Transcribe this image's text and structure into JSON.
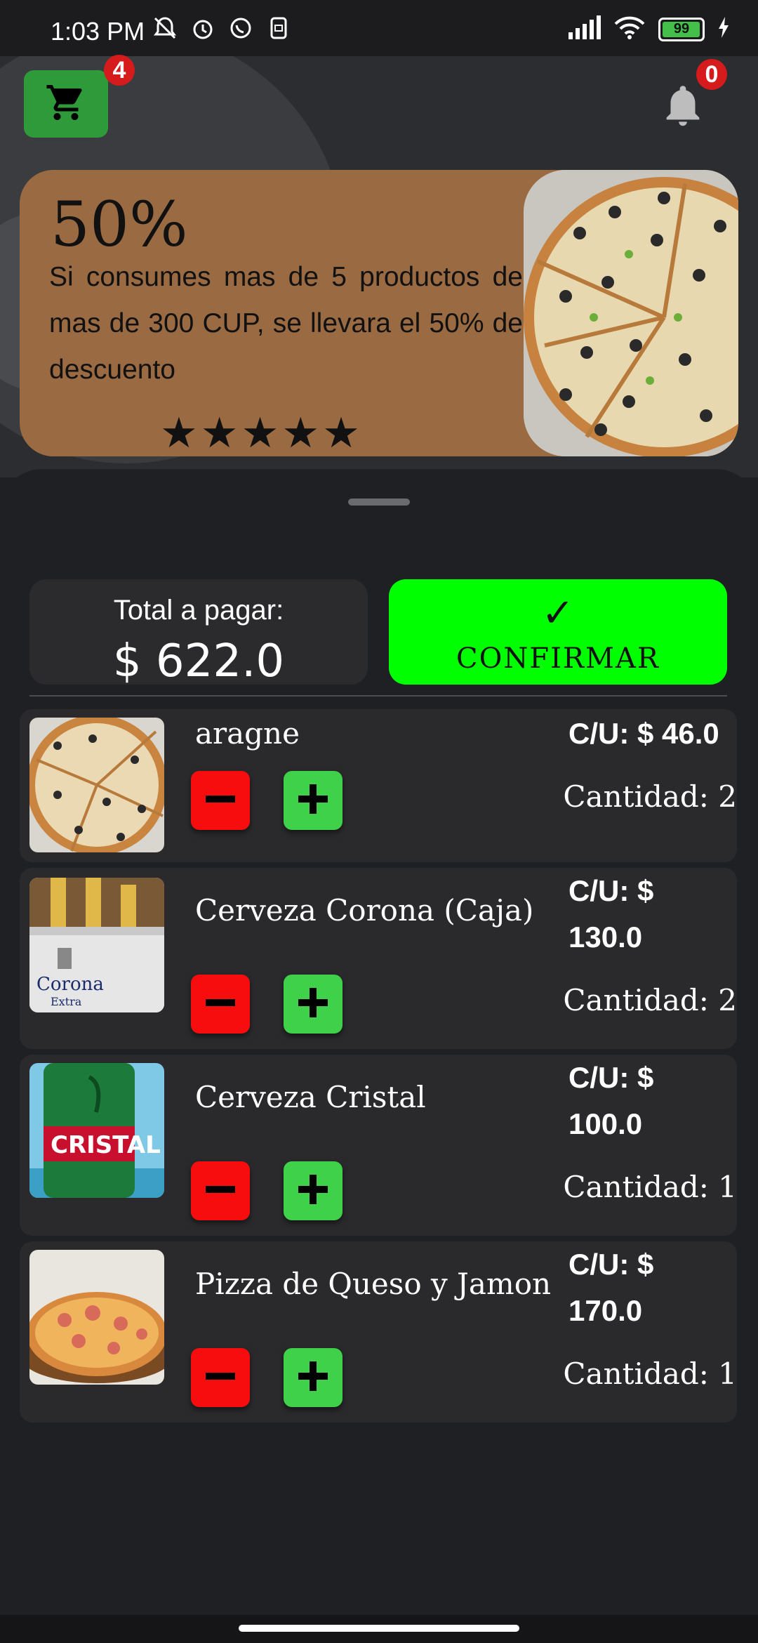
{
  "status_bar": {
    "time": "1:03 PM",
    "left_icons": [
      "notifications-off-icon",
      "alarm-icon",
      "whatsapp-icon",
      "sim-icon"
    ],
    "right_icons": [
      "signal-icon",
      "wifi-icon",
      "battery-icon",
      "charging-icon"
    ],
    "battery": "99"
  },
  "header": {
    "cart_badge": "4",
    "notification_badge": "0"
  },
  "promo": {
    "title": "50%",
    "text": "Si consumes mas de 5 productos de mas de 300 CUP, se llevara el 50% de descuento",
    "stars": "★★★★★",
    "rating": 5
  },
  "checkout": {
    "total_label": "Total a pagar:",
    "total_value": "$ 622.0",
    "confirm_icon": "✓",
    "confirm_label": "CONFIRMAR"
  },
  "products": [
    {
      "name": "aragne",
      "unit_price": "C/U: $ 46.0",
      "quantity": "Cantidad: 2"
    },
    {
      "name": "Cerveza Corona (Caja)",
      "unit_price": "C/U: $ 130.0",
      "quantity": "Cantidad: 2"
    },
    {
      "name": "Cerveza Cristal",
      "unit_price": "C/U: $ 100.0",
      "quantity": "Cantidad: 1"
    },
    {
      "name": "Pizza de Queso y Jamon",
      "unit_price": "C/U: $ 170.0",
      "quantity": "Cantidad: 1"
    }
  ],
  "colors": {
    "accent_green": "#00ff00",
    "cart_green": "#2e9a3a",
    "minus_red": "#f70d0d",
    "plus_green": "#3fd14a",
    "badge_red": "#d51b1b",
    "promo_brown": "#9a6a42"
  }
}
